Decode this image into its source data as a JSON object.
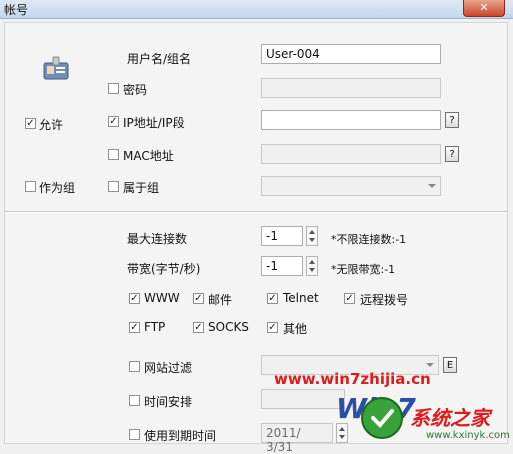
{
  "window": {
    "title": "帐号",
    "close_glyph": "✕"
  },
  "account": {
    "name_label": "用户名/组名",
    "name_value": "User-004",
    "password_label": "密码",
    "allow_label": "允许",
    "ip_label": "IP地址/IP段",
    "mac_label": "MAC地址",
    "as_group_label": "作为组",
    "belong_group_label": "属于组",
    "help_glyph": "?"
  },
  "limits": {
    "max_conn_label": "最大连接数",
    "max_conn_value": "-1",
    "max_conn_hint": "*不限连接数:-1",
    "bandwidth_label": "带宽(字节/秒)",
    "bandwidth_value": "-1",
    "bandwidth_hint": "*无限带宽:-1"
  },
  "services": {
    "www": "WWW",
    "mail": "邮件",
    "telnet": "Telnet",
    "dialup": "远程拨号",
    "ftp": "FTP",
    "socks": "SOCKS",
    "other": "其他"
  },
  "filters": {
    "site_filter_label": "网站过滤",
    "site_filter_btn": "E",
    "schedule_label": "时间安排",
    "expiry_label": "使用到期时间",
    "expiry_value": "2011/ 3/31"
  },
  "watermark": {
    "url": "www.win7zhijia.cn",
    "logo_text": "Win7",
    "brand_text": "系统之家",
    "site_text": "www.kxinyk.com"
  },
  "colors": {
    "watermark_red": "#e11a1a"
  }
}
